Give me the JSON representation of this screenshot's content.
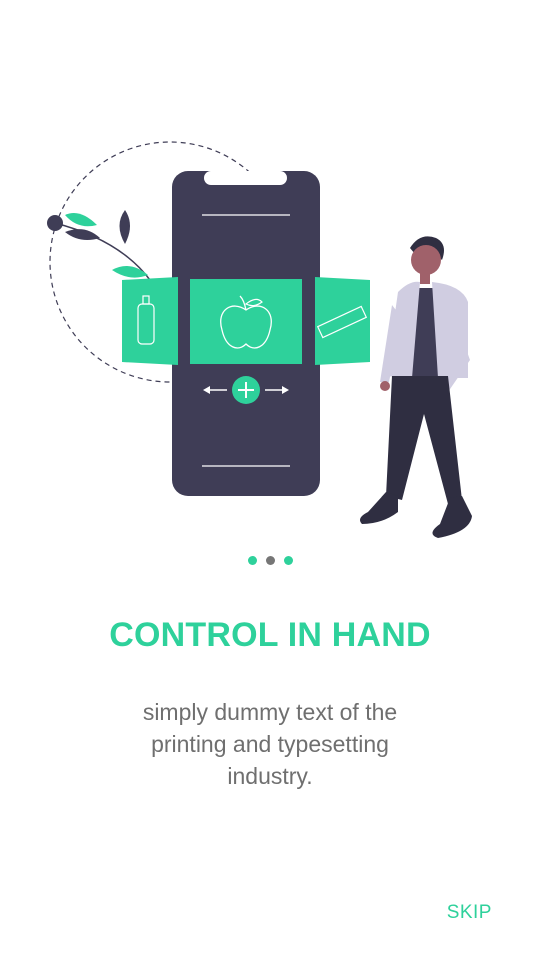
{
  "onboarding": {
    "title": "CONTROL IN HAND",
    "description": "simply dummy text of the printing and typesetting industry.",
    "skip_label": "SKIP",
    "page_indicator": {
      "total": 3,
      "active_index": 1
    }
  },
  "colors": {
    "accent": "#2ed19b",
    "phone_body": "#3f3d56",
    "text_gray": "#6f6f6f",
    "dot_inactive": "#767676"
  },
  "icons": [
    "bottle-icon",
    "apple-icon",
    "bar-icon",
    "plus-icon",
    "arrow-left-icon",
    "arrow-right-icon"
  ]
}
